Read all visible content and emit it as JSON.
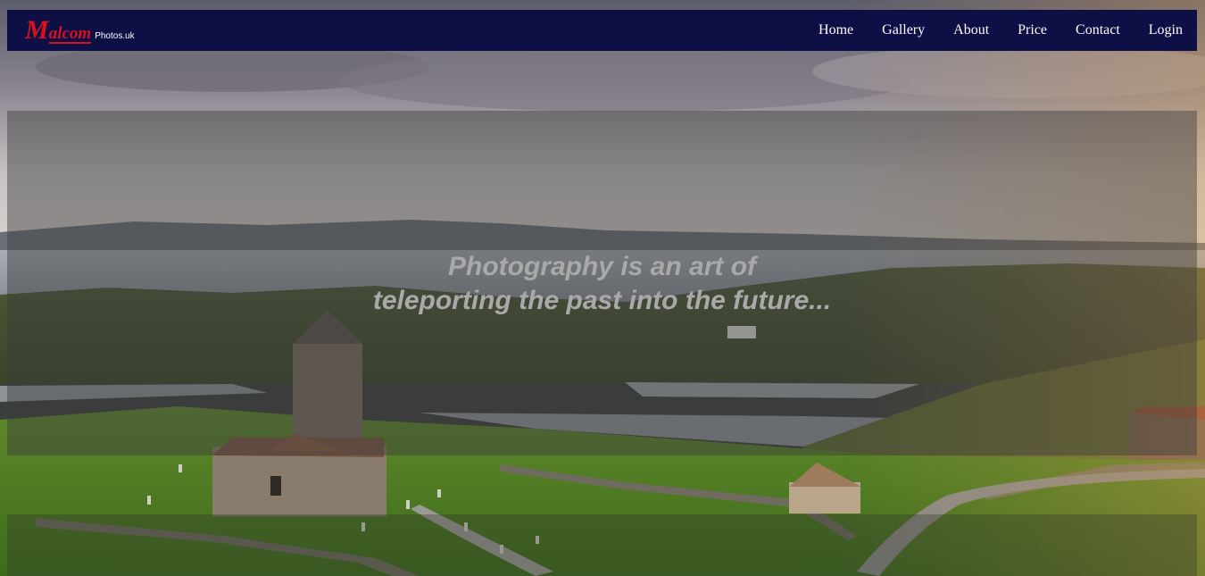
{
  "brand": {
    "initial": "M",
    "rest": "alcom",
    "domain": "Photos.uk"
  },
  "nav": {
    "items": [
      {
        "label": "Home"
      },
      {
        "label": "Gallery"
      },
      {
        "label": "About"
      },
      {
        "label": "Price"
      },
      {
        "label": "Contact"
      },
      {
        "label": "Login"
      }
    ]
  },
  "hero": {
    "line1": "Photography is an art of",
    "line2": "teleporting the past into the future..."
  },
  "colors": {
    "navbar": "#0e0f45",
    "brand": "#d8121c",
    "nav_text": "#ffffff",
    "quote_text": "#a9a9a9"
  }
}
